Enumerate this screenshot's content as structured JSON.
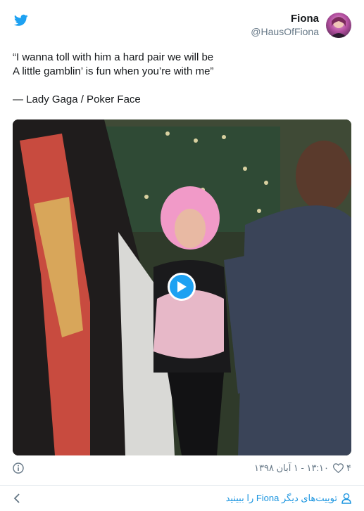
{
  "header": {
    "display_name": "Fiona",
    "handle": "@HausOfFiona",
    "brand_color": "#1da1f2"
  },
  "tweet": {
    "lines": [
      "“I wanna toll with him a hard pair we will be",
      "A little gamblin’ is fun when you’re with me”",
      "— Lady Gaga / Poker Face"
    ]
  },
  "media": {
    "type": "video",
    "play_icon": "play-icon"
  },
  "footer": {
    "like_count": "۴",
    "timestamp": "۱۳:۱۰ - ۱ آبان ۱۳۹۸",
    "info_icon": "info-icon",
    "like_icon": "heart-icon"
  },
  "more": {
    "label": "توییت‌های دیگر Fiona را ببینید",
    "icon": "user-icon",
    "back_icon": "chevron-left-icon"
  }
}
